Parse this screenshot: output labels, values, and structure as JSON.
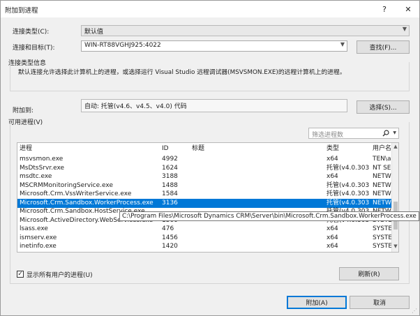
{
  "window": {
    "title": "附加到进程",
    "help_glyph": "?",
    "close_glyph": "✕"
  },
  "connection_type": {
    "label": "连接类型(C):",
    "value": "默认值"
  },
  "connection_target": {
    "label": "连接和目标(T):",
    "value": "WIN-RT88VGHJ925:4022",
    "find_button": "查找(F)..."
  },
  "connection_info": {
    "group_label": "连接类型信息",
    "text": "默认连接允许选择此计算机上的进程，或选择运行 Visual Studio 远程调试器(MSVSMON.EXE)的远程计算机上的进程。"
  },
  "attach_to": {
    "label": "附加到:",
    "value": "自动: 托管(v4.6、v4.5、v4.0) 代码",
    "select_button": "选择(S)..."
  },
  "available_processes": {
    "label": "可用进程(V)",
    "filter_placeholder": "筛选进程数",
    "columns": [
      "进程",
      "ID",
      "标题",
      "类型",
      "用户名"
    ],
    "rows": [
      {
        "process": "msvsmon.exe",
        "id": "4992",
        "title": "",
        "type": "x64",
        "user": "TEN\\a"
      },
      {
        "process": "MsDtsSrvr.exe",
        "id": "1624",
        "title": "",
        "type": "托管(v4.0.303...",
        "user": "NT SE"
      },
      {
        "process": "msdtc.exe",
        "id": "3188",
        "title": "",
        "type": "x64",
        "user": "NETW"
      },
      {
        "process": "MSCRMMonitoringService.exe",
        "id": "1488",
        "title": "",
        "type": "托管(v4.0.303...",
        "user": "NETW"
      },
      {
        "process": "Microsoft.Crm.VssWriterService.exe",
        "id": "1584",
        "title": "",
        "type": "托管(v4.0.303...",
        "user": "NETW"
      },
      {
        "process": "Microsoft.Crm.Sandbox.WorkerProcess.exe",
        "id": "3136",
        "title": "",
        "type": "托管(v4.0.303...",
        "user": "NETW",
        "selected": true
      },
      {
        "process": "Microsoft.Crm.Sandbox.HostService.exe",
        "id": "",
        "title": "",
        "type": "托管(v4.0.303...",
        "user": "NETW"
      },
      {
        "process": "Microsoft.ActiveDirectory.WebServices.exe",
        "id": "1500",
        "title": "",
        "type": "托管(v4.0.303...",
        "user": "SYSTE"
      },
      {
        "process": "lsass.exe",
        "id": "476",
        "title": "",
        "type": "x64",
        "user": "SYSTE"
      },
      {
        "process": "ismserv.exe",
        "id": "1456",
        "title": "",
        "type": "x64",
        "user": "SYSTE"
      },
      {
        "process": "inetinfo.exe",
        "id": "1420",
        "title": "",
        "type": "x64",
        "user": "SYSTE"
      }
    ],
    "tooltip": "C:\\Program Files\\Microsoft Dynamics CRM\\Server\\bin\\Microsoft.Crm.Sandbox.WorkerProcess.exe"
  },
  "show_all_users": {
    "label": "显示所有用户的进程(U)",
    "checked": true,
    "check_glyph": "✓"
  },
  "refresh_button": "刷新(R)",
  "attach_button": "附加(A)",
  "cancel_button": "取消",
  "glyphs": {
    "dropdown": "▼",
    "scroll_up": "▲",
    "scroll_down": "▼",
    "size_grip": "⋰"
  },
  "colors": {
    "selection": "#0078d7",
    "default_button_border": "#0078d7",
    "dialog_bg": "#f0f0f0"
  }
}
